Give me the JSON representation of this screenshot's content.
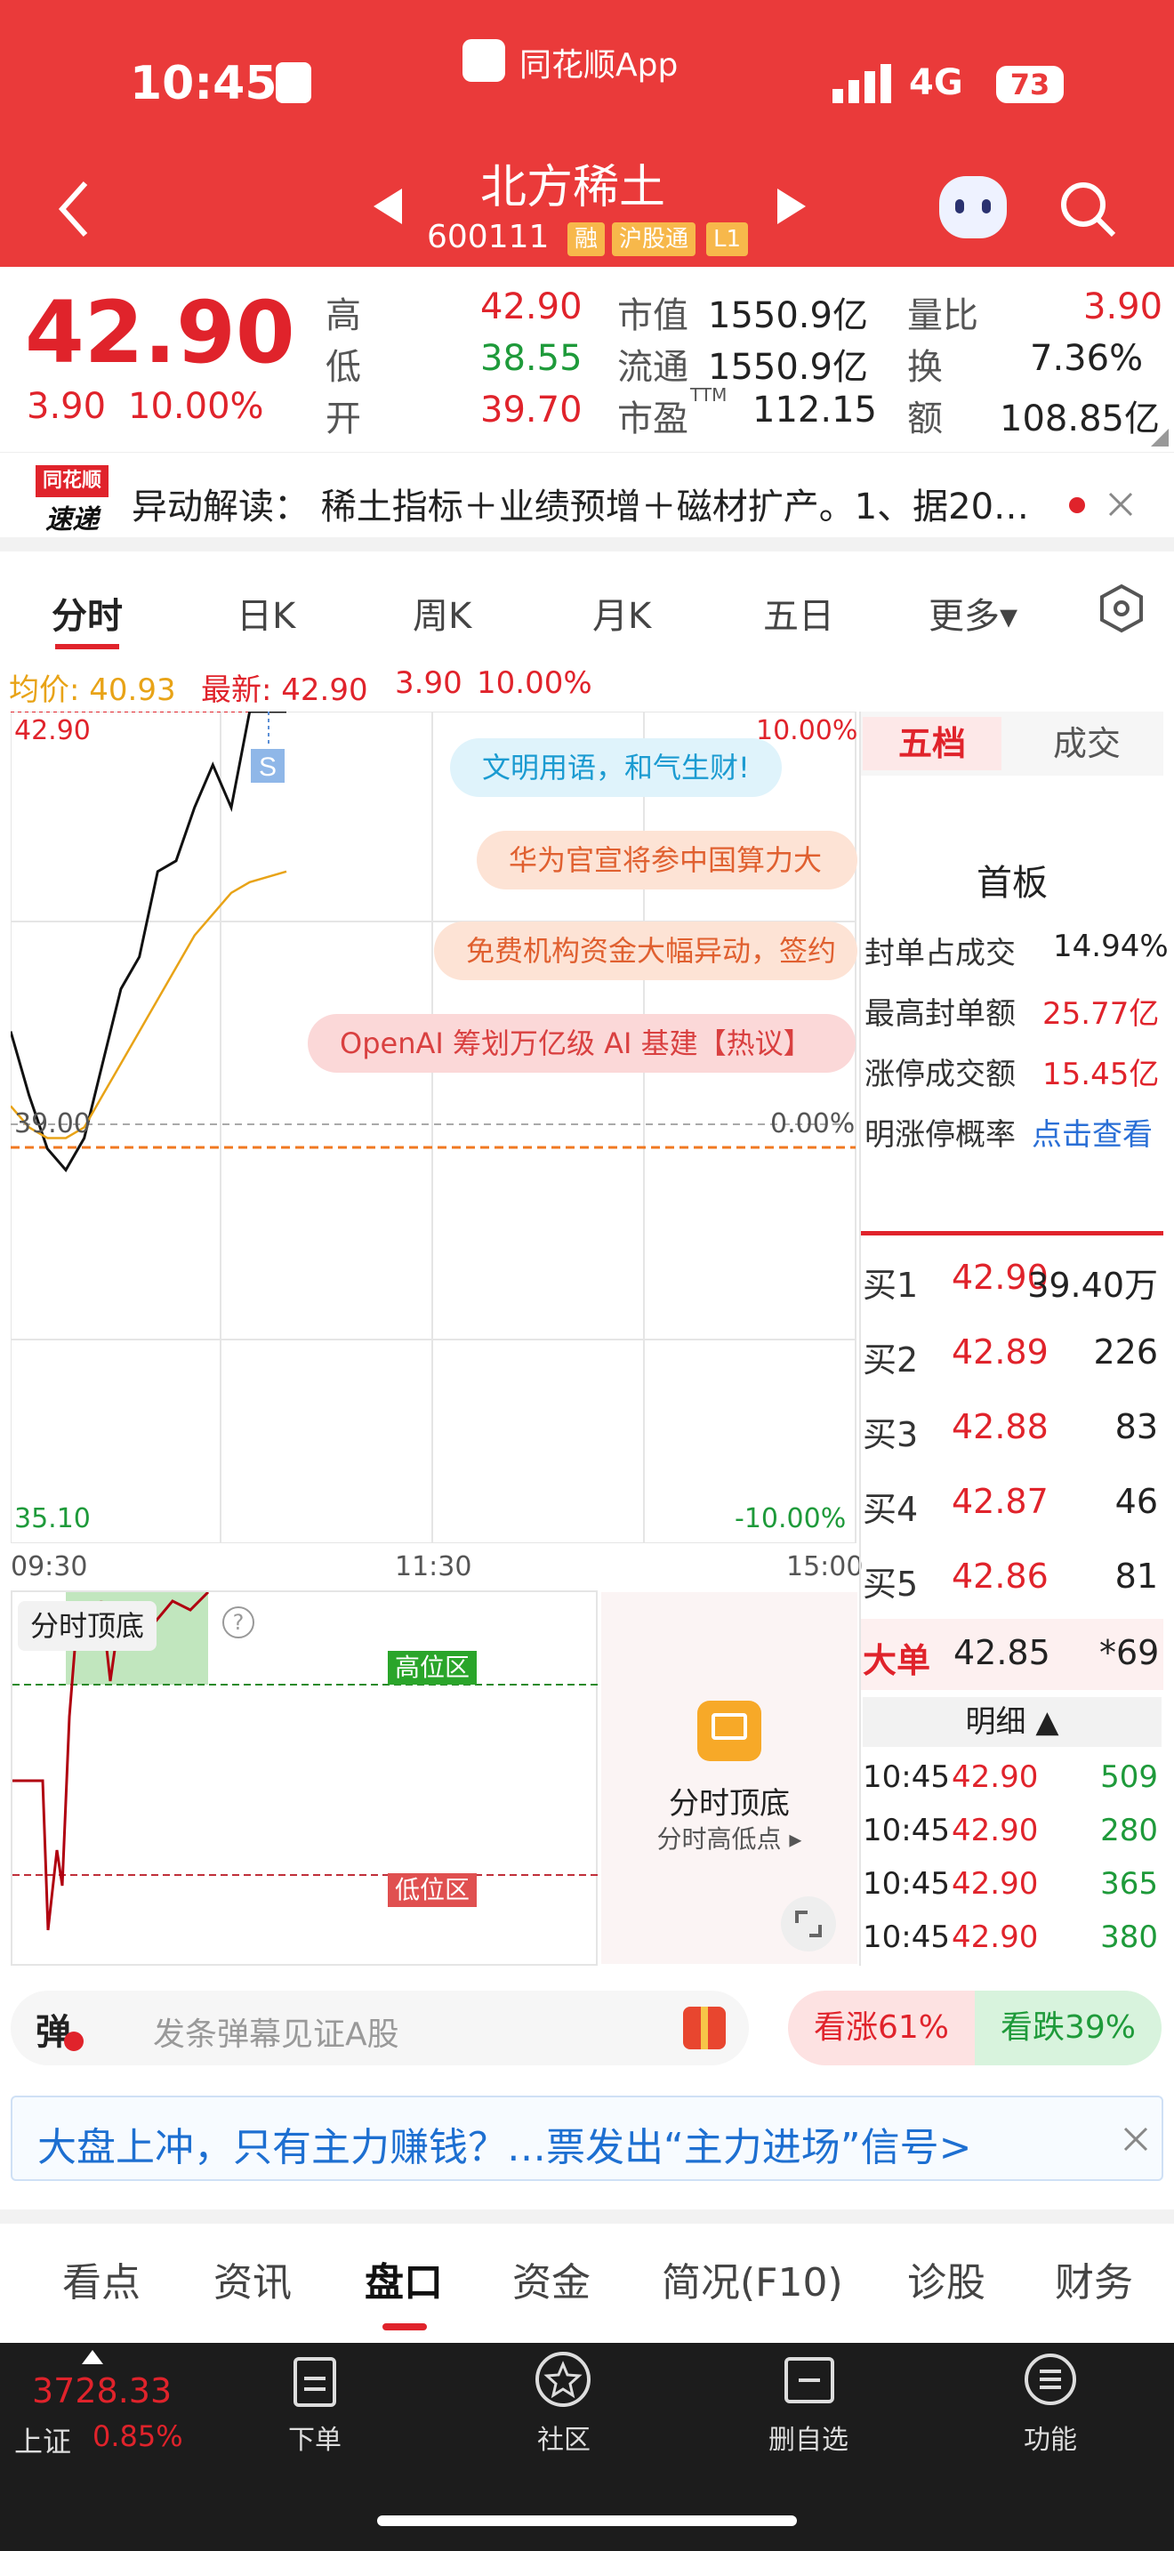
{
  "status_bar": {
    "time": "10:45",
    "app_name": "同花顺App",
    "network": "4G",
    "battery": "73"
  },
  "header": {
    "stock_name": "北方稀土",
    "stock_code": "600111",
    "tags": [
      "融",
      "沪股通",
      "L1"
    ]
  },
  "quote": {
    "price": "42.90",
    "change": "3.90",
    "change_pct": "10.00%",
    "high_label": "高",
    "high": "42.90",
    "low_label": "低",
    "low": "38.55",
    "open_label": "开",
    "open": "39.70",
    "mktcap_label": "市值",
    "mktcap": "1550.9亿",
    "float_label": "流通",
    "float": "1550.9亿",
    "pe_label": "市盈",
    "pe_sup": "TTM",
    "pe": "112.15",
    "volratio_label": "量比",
    "volratio": "3.90",
    "turnover_label": "换",
    "turnover": "7.36%",
    "amount_label": "额",
    "amount": "108.85亿"
  },
  "notice": {
    "logo_top": "同花顺",
    "logo_bottom": "速递",
    "text": "异动解读： 稀土指标＋业绩预增＋磁材扩产。1、据20…"
  },
  "chart_tabs": [
    "分时",
    "日K",
    "周K",
    "月K",
    "五日",
    "更多▾"
  ],
  "intraday": {
    "avg_label": "均价: 40.93",
    "latest_label": "最新: 42.90",
    "change": "3.90",
    "change_pct": "10.00%",
    "y_top": "42.90",
    "y_mid": "39.00",
    "y_bottom": "35.10",
    "pct_top": "10.00%",
    "pct_mid": "0.00%",
    "pct_bottom": "-10.00%",
    "x_labels": [
      "09:30",
      "11:30",
      "15:00"
    ],
    "sell_marker": "S",
    "danmu": [
      "文明用语，和气生财!",
      "华为官宣将参中国算力大",
      "免费机构资金大幅异动，签约",
      "OpenAI 筹划万亿级 AI 基建【热议】"
    ]
  },
  "chart_data": {
    "type": "line",
    "y_range": [
      35.1,
      42.9
    ],
    "series": [
      {
        "name": "最新",
        "values": [
          39.9,
          39.3,
          38.8,
          38.6,
          38.9,
          39.6,
          40.3,
          40.6,
          41.4,
          41.5,
          42.0,
          42.4,
          42.0,
          42.9,
          42.9,
          42.9
        ]
      },
      {
        "name": "均价",
        "values": [
          39.2,
          39.0,
          38.9,
          38.9,
          39.0,
          39.3,
          39.6,
          39.9,
          40.2,
          40.5,
          40.8,
          41.0,
          41.2,
          41.3,
          41.35,
          41.4
        ]
      }
    ]
  },
  "indicator": {
    "name": "分时顶底",
    "high_zone": "高位区",
    "low_zone": "低位区",
    "promo_title": "分时顶底",
    "promo_sub": "分时高低点 ▸"
  },
  "orderbook": {
    "tabs": [
      "五档",
      "成交"
    ],
    "board_title": "首板",
    "stats": [
      {
        "label": "封单占成交",
        "value": "14.94%"
      },
      {
        "label": "最高封单额",
        "value": "25.77亿"
      },
      {
        "label": "涨停成交额",
        "value": "15.45亿"
      },
      {
        "label": "明涨停概率",
        "value": "点击查看"
      }
    ],
    "bids": [
      {
        "label": "买1",
        "price": "42.90",
        "vol": "39.40万"
      },
      {
        "label": "买2",
        "price": "42.89",
        "vol": "226"
      },
      {
        "label": "买3",
        "price": "42.88",
        "vol": "83"
      },
      {
        "label": "买4",
        "price": "42.87",
        "vol": "46"
      },
      {
        "label": "买5",
        "price": "42.86",
        "vol": "81"
      }
    ],
    "big": {
      "label": "大单",
      "price": "42.85",
      "vol": "*69"
    },
    "detail_label": "明细 ▲",
    "ticks": [
      {
        "time": "10:45",
        "price": "42.90",
        "vol": "509"
      },
      {
        "time": "10:45",
        "price": "42.90",
        "vol": "280"
      },
      {
        "time": "10:45",
        "price": "42.90",
        "vol": "365"
      },
      {
        "time": "10:45",
        "price": "42.90",
        "vol": "380"
      }
    ]
  },
  "danmu_bar": {
    "icon": "弹",
    "placeholder": "发条弹幕见证A股",
    "up": "看涨61%",
    "down": "看跌39%"
  },
  "ad": {
    "text": "大盘上冲，只有主力赚钱？…票发出“主力进场”信号>"
  },
  "bottom_tabs": [
    "看点",
    "资讯",
    "盘口",
    "资金",
    "简况(F10)",
    "诊股",
    "财务"
  ],
  "dock": {
    "index_value": "3728.33",
    "index_name": "上证",
    "index_pct": "0.85%",
    "items": [
      "下单",
      "社区",
      "删自选",
      "功能"
    ]
  }
}
